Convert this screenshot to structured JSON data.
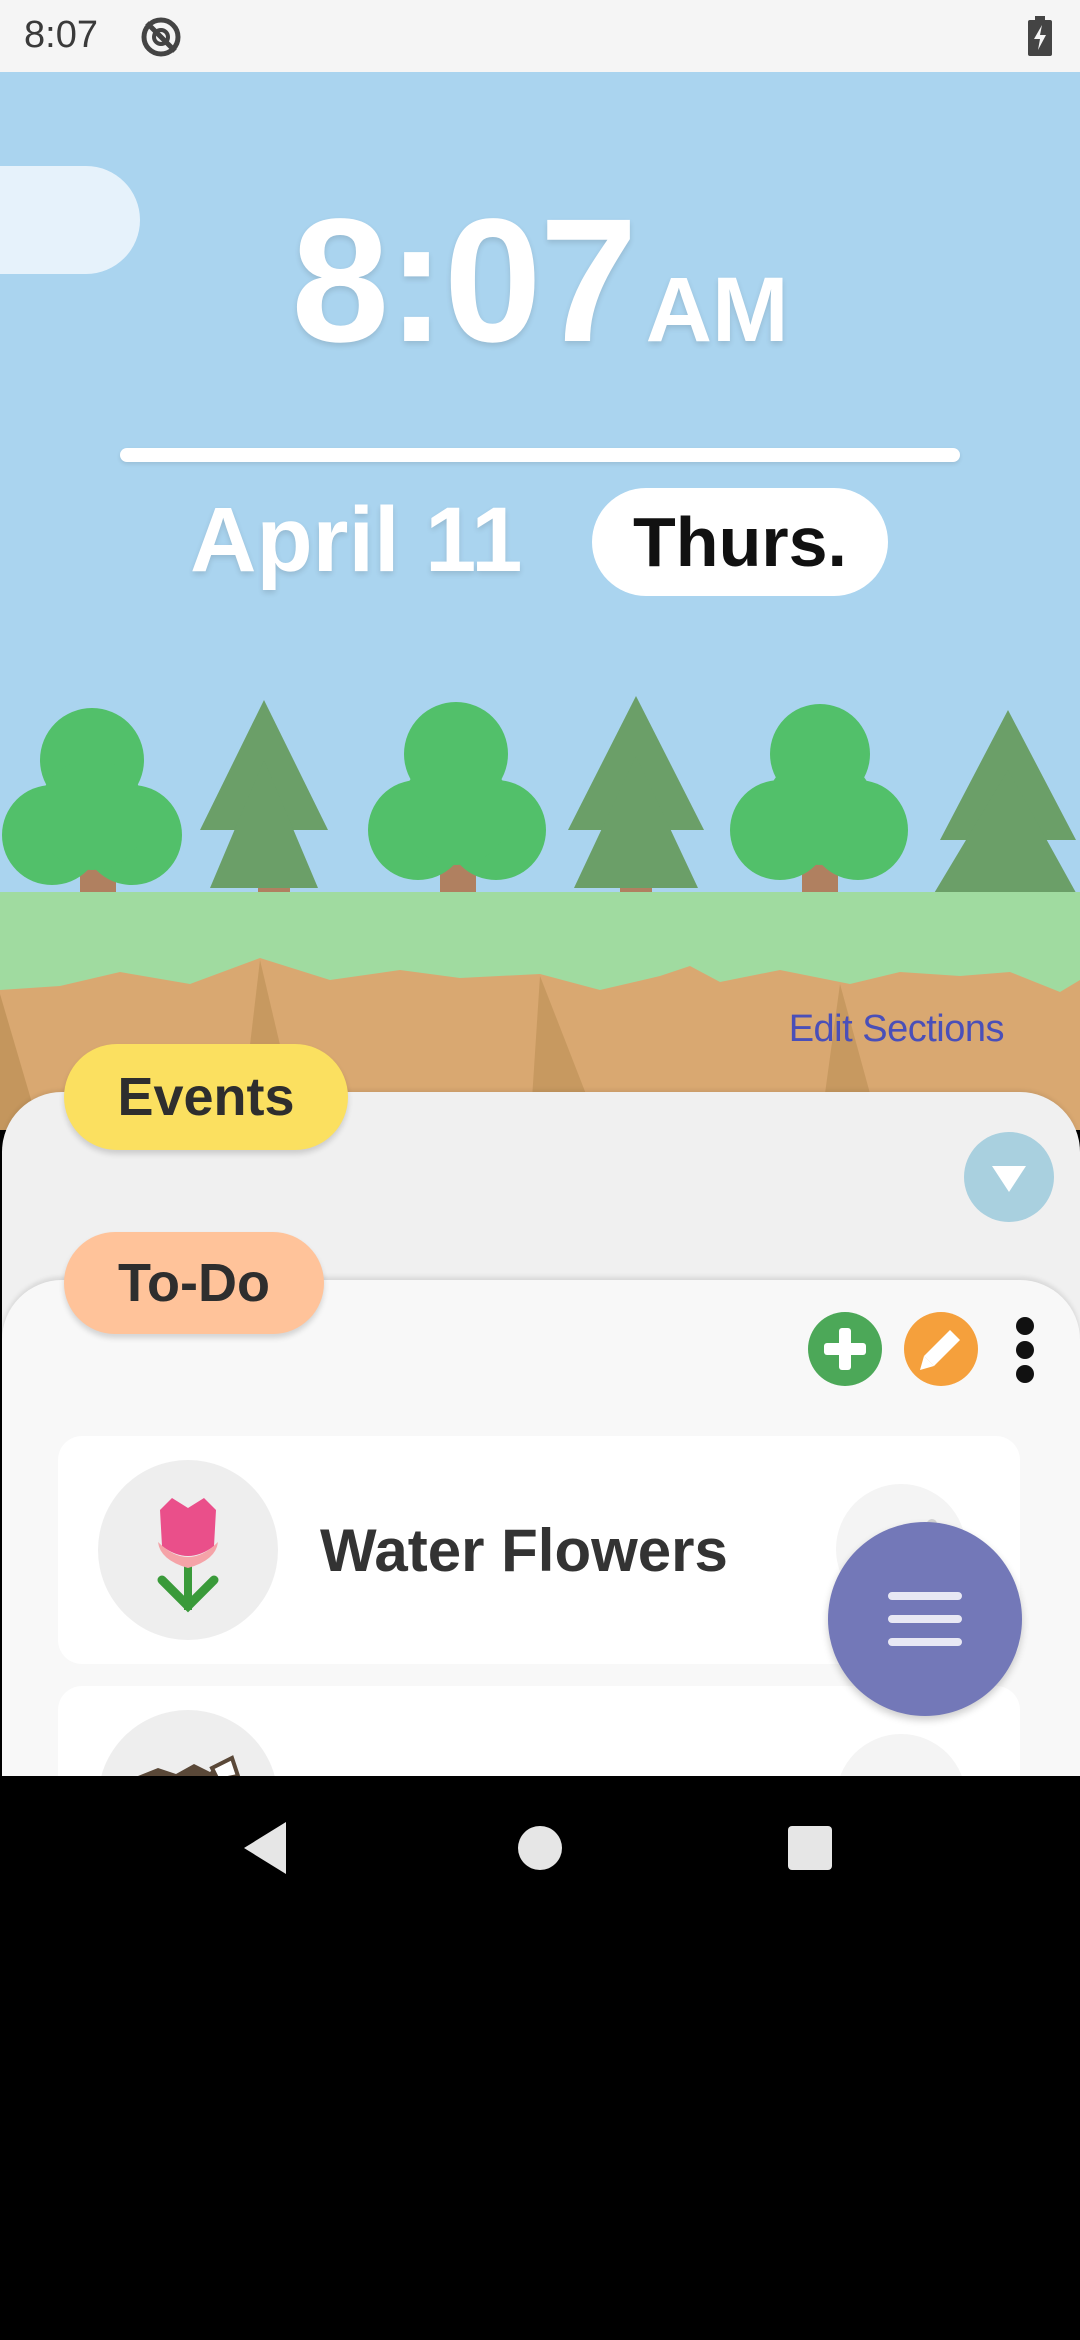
{
  "status_bar": {
    "time": "8:07",
    "icons": [
      "sync-off-icon",
      "battery-charging-icon"
    ]
  },
  "clock": {
    "time": "8:07",
    "ampm": "AM",
    "date": "April 11",
    "day": "Thurs."
  },
  "scene": {
    "edit_sections": "Edit Sections"
  },
  "sections": {
    "events_label": "Events",
    "todo_label": "To-Do"
  },
  "todo_items": [
    {
      "label": "Water Flowers",
      "icon": "tulip-icon"
    },
    {
      "label": "",
      "icon": "trash-bin-icon"
    }
  ],
  "colors": {
    "sky": "#aad4ef",
    "events_tab": "#fbe060",
    "todo_tab": "#ffc39a",
    "add_button": "#4ca858",
    "edit_button": "#f5a03c",
    "fab": "#7378b8",
    "edit_sections_text": "#4a4fb8"
  }
}
